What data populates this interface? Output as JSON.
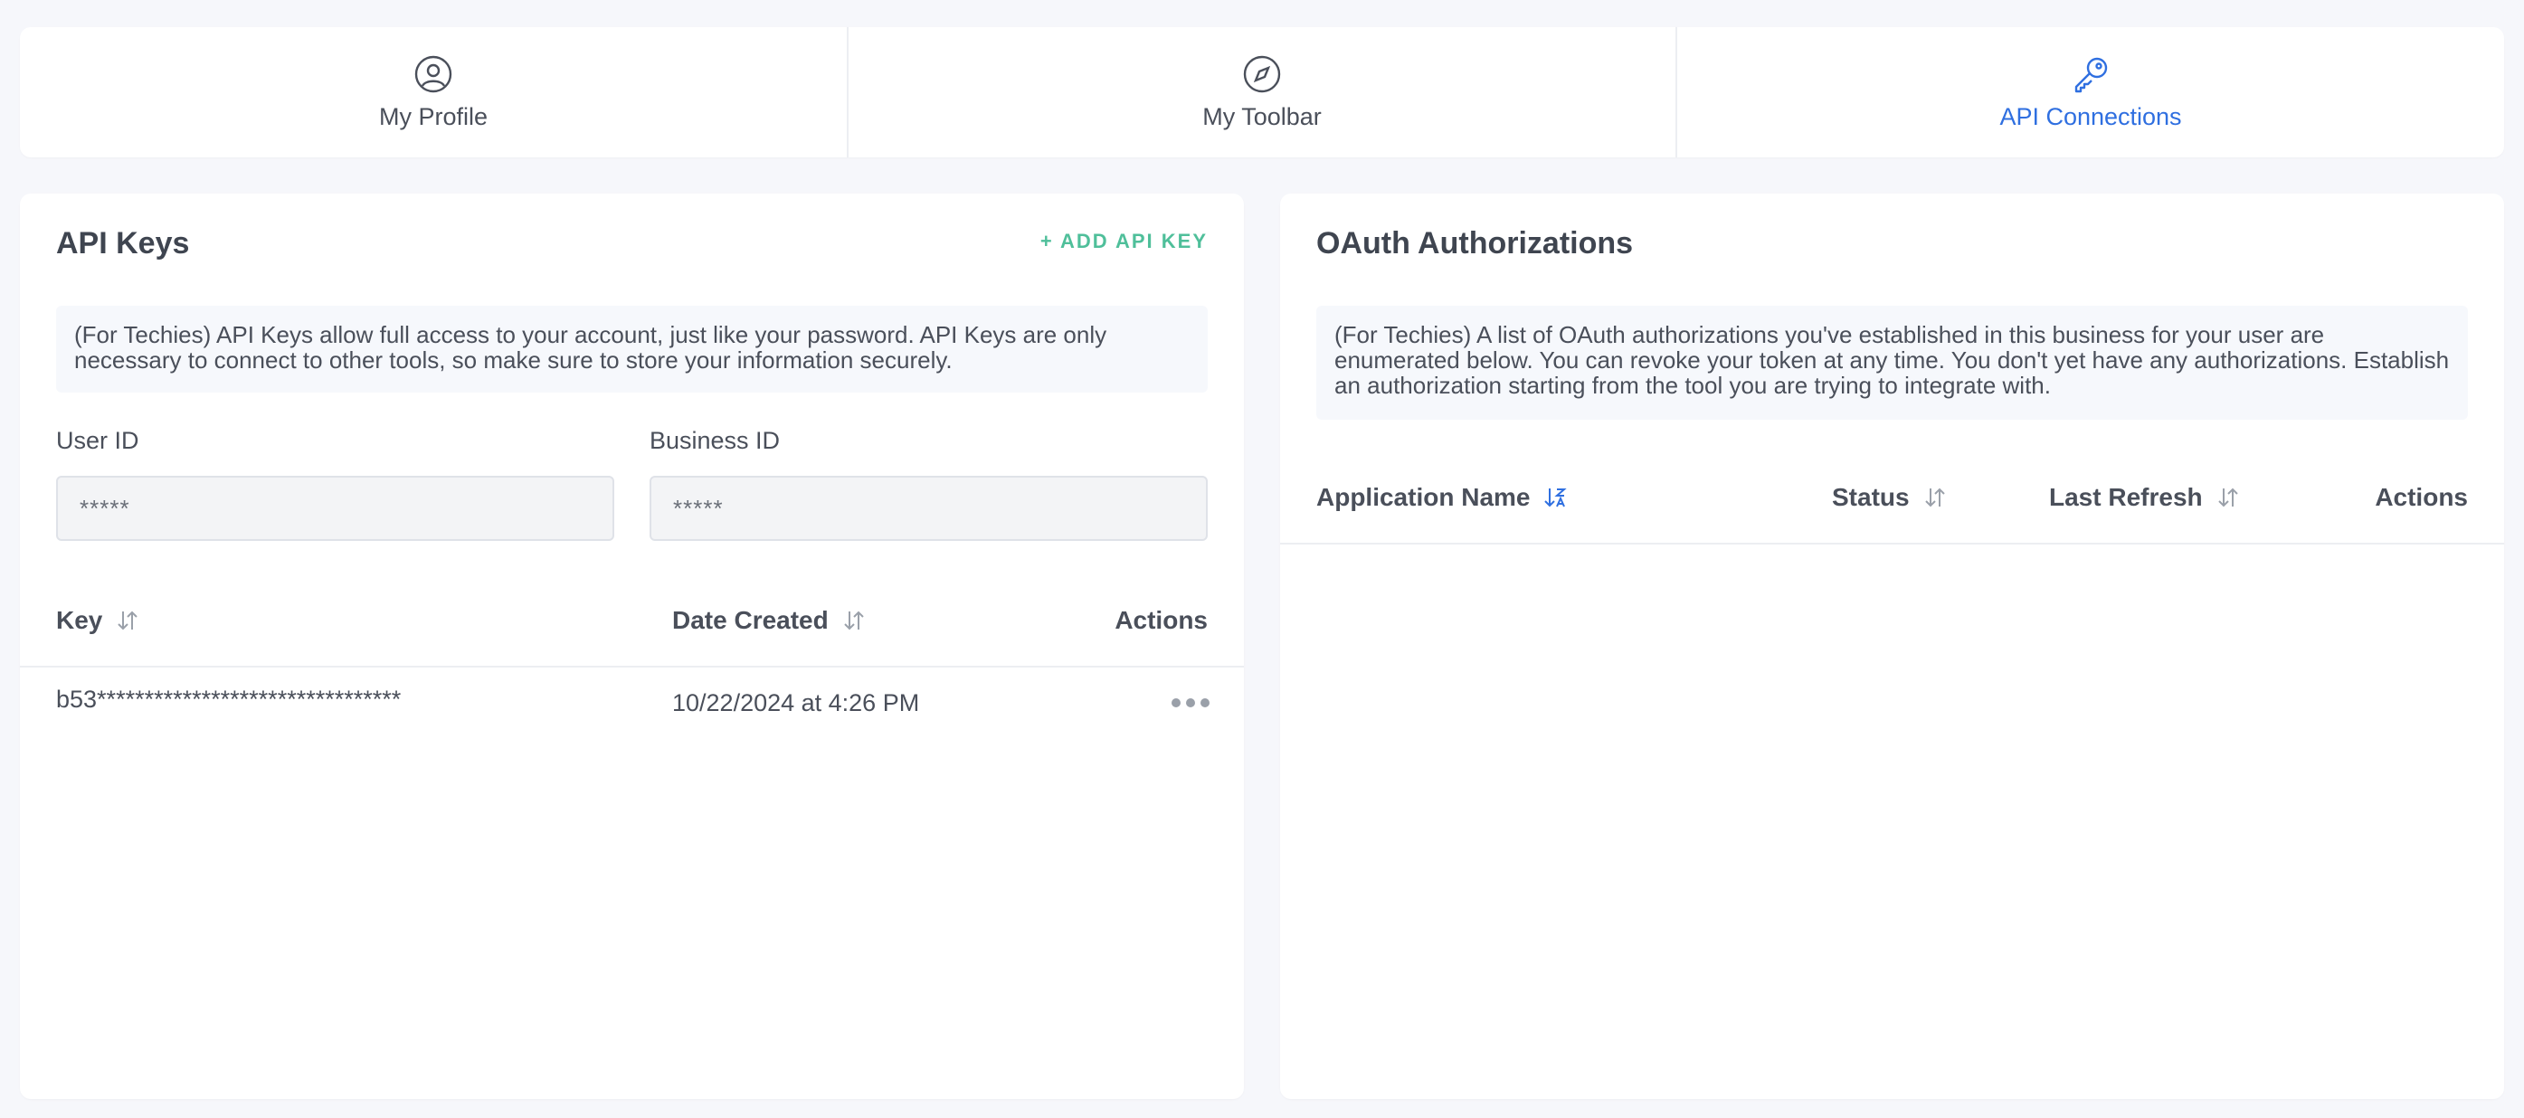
{
  "tabs": [
    {
      "label": "My Profile",
      "icon": "user-circle-icon",
      "active": false
    },
    {
      "label": "My Toolbar",
      "icon": "compass-icon",
      "active": false
    },
    {
      "label": "API Connections",
      "icon": "key-icon",
      "active": true
    }
  ],
  "colors": {
    "accent": "#2f6fe0",
    "add": "#4fbf9a",
    "text": "#4a4f5a"
  },
  "api_keys": {
    "title": "API Keys",
    "add_label": "+ ADD API KEY",
    "info": "(For Techies) API Keys allow full access to your account, just like your password. API Keys are only necessary to connect to other tools, so make sure to store your information securely.",
    "user_id_label": "User ID",
    "user_id_value": "*****",
    "business_id_label": "Business ID",
    "business_id_value": "*****",
    "columns": {
      "key": "Key",
      "date": "Date Created",
      "actions": "Actions"
    },
    "rows": [
      {
        "key": "b53********************************",
        "date": "10/22/2024 at 4:26 PM"
      }
    ]
  },
  "oauth": {
    "title": "OAuth Authorizations",
    "info": "(For Techies) A list of OAuth authorizations you've established in this business for your user are enumerated below. You can revoke your token at any time. You don't yet have any authorizations. Establish an authorization starting from the tool you are trying to integrate with.",
    "columns": {
      "app": "Application Name",
      "status": "Status",
      "refresh": "Last Refresh",
      "actions": "Actions"
    }
  }
}
